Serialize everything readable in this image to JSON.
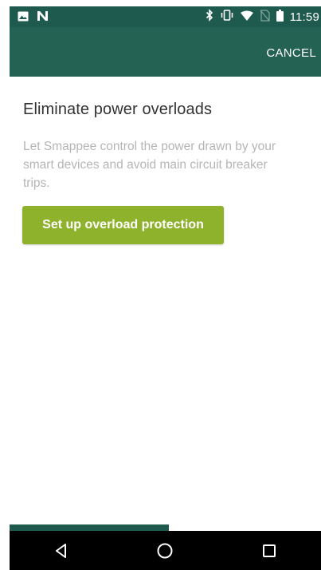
{
  "status_bar": {
    "time": "11:59",
    "left_icons": [
      "image-icon",
      "n-notification-icon"
    ],
    "right_icons": [
      "bluetooth-icon",
      "vibrate-icon",
      "wifi-icon",
      "no-sim-icon",
      "battery-icon"
    ]
  },
  "app_bar": {
    "cancel_label": "CANCEL"
  },
  "card": {
    "title": "Eliminate power overloads",
    "description": "Let Smappee control the power drawn by your smart devices and avoid main circuit breaker trips.",
    "button_label": "Set up overload protection"
  },
  "nav_bar": {
    "icons": [
      "back-icon",
      "home-icon",
      "recents-icon"
    ]
  },
  "colors": {
    "status_bar": "#1f5a4f",
    "app_bar": "#246253",
    "button": "#8fb22d",
    "title_text": "#333333",
    "description_text": "#b5b5b5"
  }
}
